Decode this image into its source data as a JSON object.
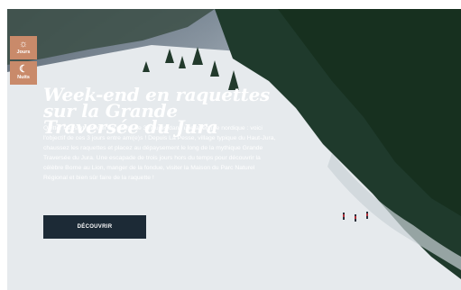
{
  "side_tabs": [
    {
      "icon": "sun-icon",
      "glyph": "☼",
      "label": "Jours"
    },
    {
      "icon": "moon-icon",
      "glyph": "☾",
      "label": "Nuits"
    }
  ],
  "hero": {
    "title": "Week-end en raquettes sur la Grande Traversée du Jura",
    "description": "Quitter Paris et plonger en moins de 3 heures dans une aventure nordique : voici l'objectif de ces 3 jours entre ami(e)s ! Depuis La Pesse, village typique du Haut-Jura, chaussez les raquettes et placez au dépaysement le long de la mythique Grande Traversée du Jura. Une escapade de trois jours hors du temps pour découvrir la célèbre Borne au Lion, manger de la fondue, visiter la Maison du Parc Naturel Régional et bien sûr faire de la raquette !",
    "cta_label": "DÉCOUVRIR",
    "copyright_symbol": "©"
  },
  "colors": {
    "tab_bg": "#c98a6a",
    "cta_bg": "#1c2a36",
    "forest": "#1f3a2c",
    "snow": "#eef1f3"
  }
}
